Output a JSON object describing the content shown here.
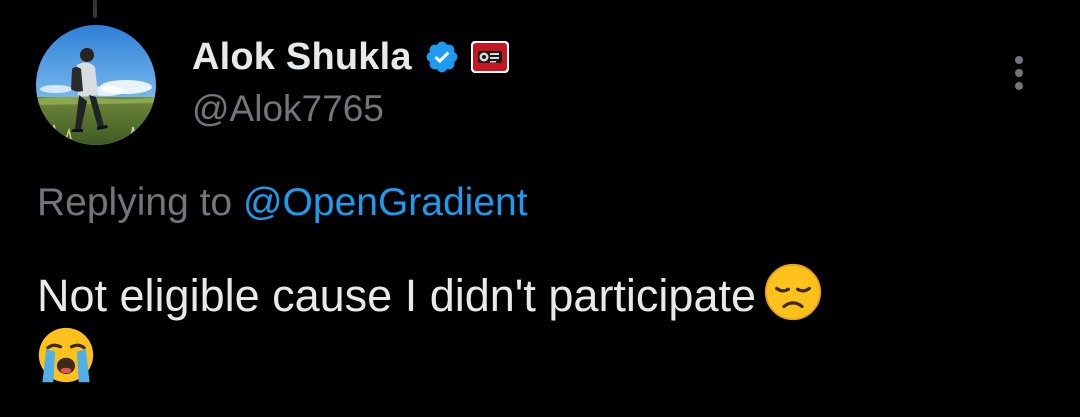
{
  "tweet": {
    "author": {
      "display_name": "Alok Shukla",
      "handle": "@Alok7765",
      "verified": true,
      "avatar_icon": "avatar-photo",
      "affiliate_badge_icon": "affiliate-badge-icon"
    },
    "reply": {
      "prefix": "Replying to",
      "target": "@OpenGradient"
    },
    "text": "Not eligible cause I didn't participate",
    "emojis": [
      "disappointed-face-emoji",
      "loudly-crying-face-emoji"
    ],
    "more_options_icon": "more-vertical-icon"
  },
  "colors": {
    "background": "#000000",
    "primary_text": "#e7e9ea",
    "secondary_text": "#71767b",
    "link": "#1d9bf0",
    "verified": "#1d9bf0"
  }
}
